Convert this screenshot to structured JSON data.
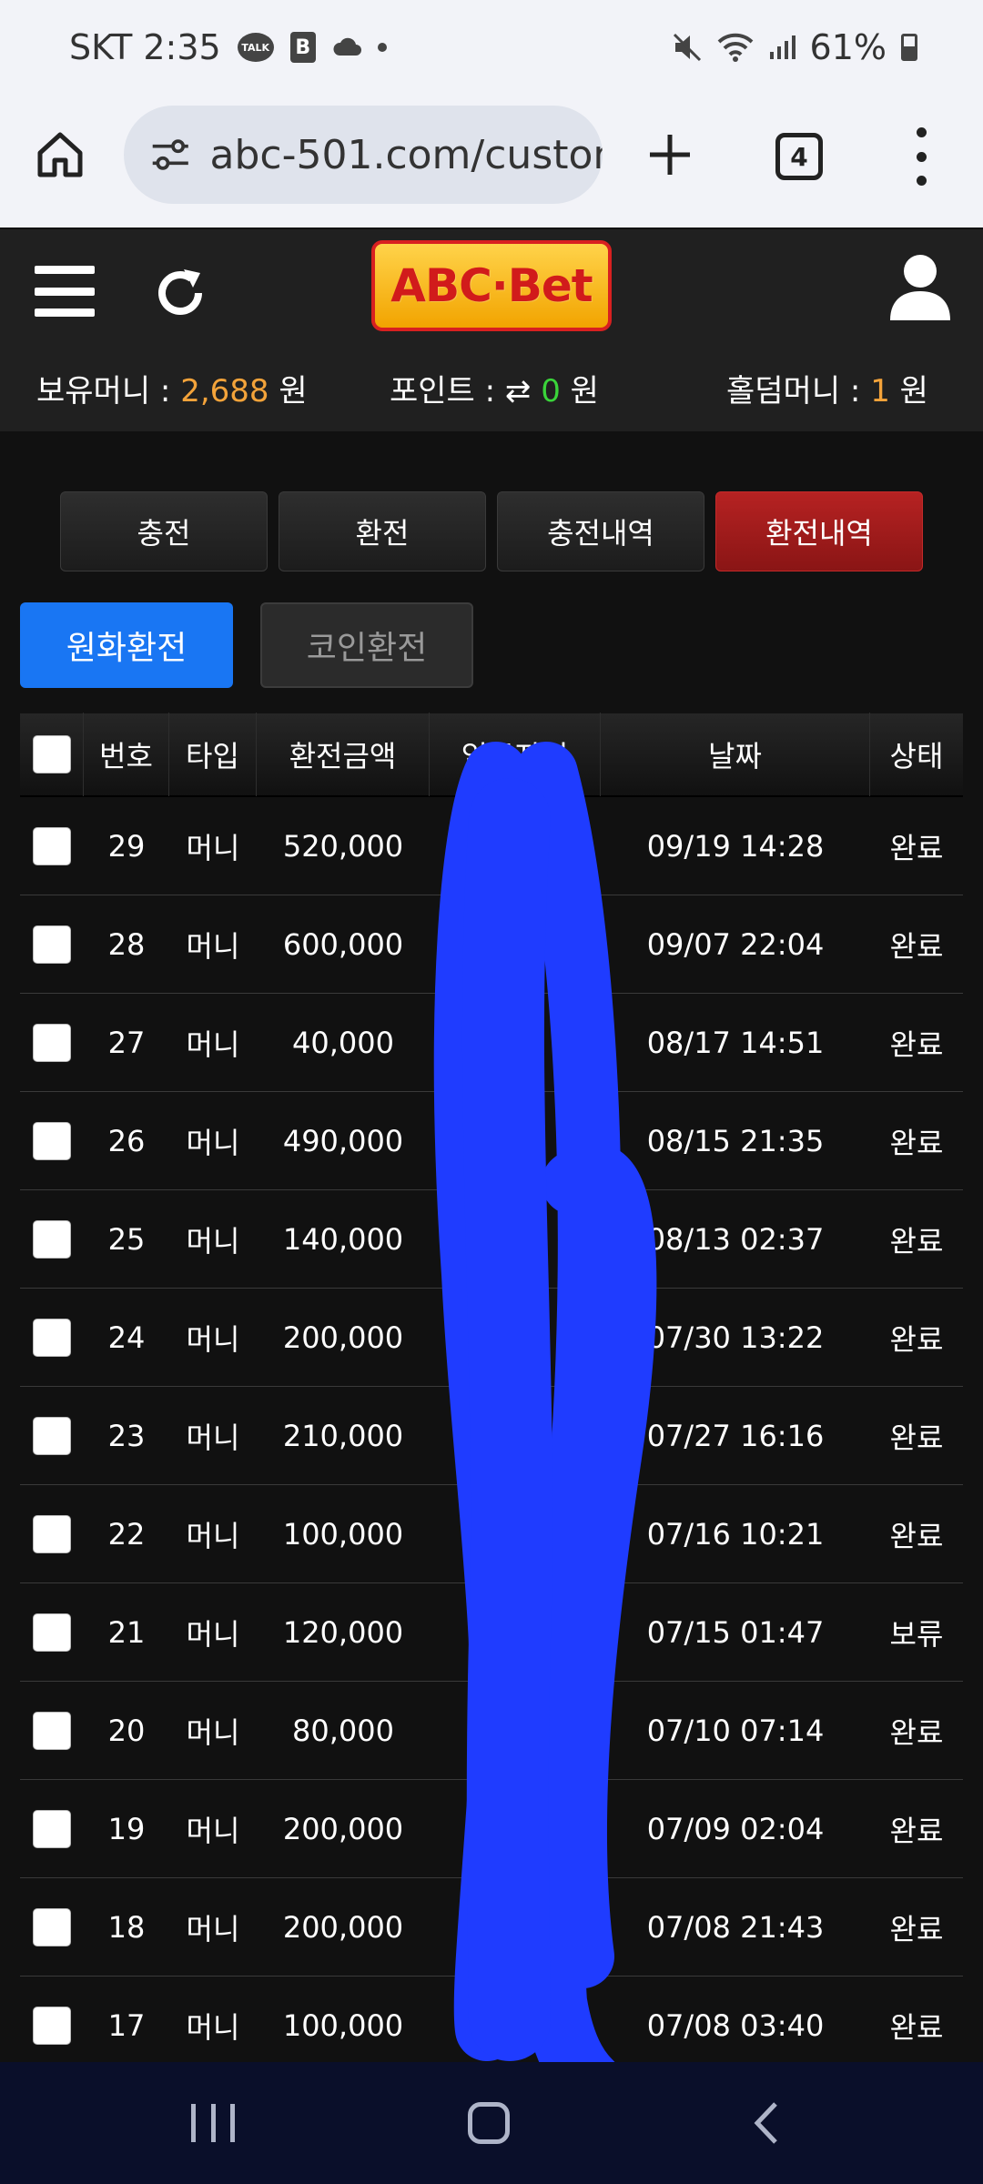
{
  "status": {
    "carrier_time": "SKT 2:35",
    "talk_label": "TALK",
    "b_label": "B",
    "battery": "61%"
  },
  "browser": {
    "url": "abc-501.com/custom",
    "tab_count": "4"
  },
  "header": {
    "logo": "ABC·Bet",
    "balance_label": "보유머니 : ",
    "balance_value": "2,688",
    "balance_unit": " 원",
    "point_label": "포인트 : ",
    "point_value": "0",
    "point_unit": " 원",
    "holdem_label": "홀덤머니 : ",
    "holdem_value": "1",
    "holdem_unit": " 원"
  },
  "tabs": [
    "충전",
    "환전",
    "충전내역",
    "환전내역"
  ],
  "subtabs": [
    "원화환전",
    "코인환전"
  ],
  "table": {
    "headers": [
      "번호",
      "타입",
      "환전금액",
      "입금자명",
      "날짜",
      "상태"
    ],
    "rows": [
      {
        "no": "29",
        "type": "머니",
        "amount": "520,000",
        "date": "09/19 14:28",
        "status": "완료"
      },
      {
        "no": "28",
        "type": "머니",
        "amount": "600,000",
        "date": "09/07 22:04",
        "status": "완료"
      },
      {
        "no": "27",
        "type": "머니",
        "amount": "40,000",
        "date": "08/17 14:51",
        "status": "완료"
      },
      {
        "no": "26",
        "type": "머니",
        "amount": "490,000",
        "date": "08/15 21:35",
        "status": "완료"
      },
      {
        "no": "25",
        "type": "머니",
        "amount": "140,000",
        "date": "08/13 02:37",
        "status": "완료"
      },
      {
        "no": "24",
        "type": "머니",
        "amount": "200,000",
        "date": "07/30 13:22",
        "status": "완료"
      },
      {
        "no": "23",
        "type": "머니",
        "amount": "210,000",
        "date": "07/27 16:16",
        "status": "완료"
      },
      {
        "no": "22",
        "type": "머니",
        "amount": "100,000",
        "date": "07/16 10:21",
        "status": "완료"
      },
      {
        "no": "21",
        "type": "머니",
        "amount": "120,000",
        "date": "07/15 01:47",
        "status": "보류"
      },
      {
        "no": "20",
        "type": "머니",
        "amount": "80,000",
        "date": "07/10 07:14",
        "status": "완료"
      },
      {
        "no": "19",
        "type": "머니",
        "amount": "200,000",
        "date": "07/09 02:04",
        "status": "완료"
      },
      {
        "no": "18",
        "type": "머니",
        "amount": "200,000",
        "date": "07/08 21:43",
        "status": "완료"
      },
      {
        "no": "17",
        "type": "머니",
        "amount": "100,000",
        "date": "07/08 03:40",
        "status": "완료"
      }
    ]
  },
  "colors": {
    "accent_blue": "#1976f3",
    "active_tab_red": "#b62222",
    "balance_orange": "#f3a33a",
    "point_green": "#3ad43a",
    "redaction_blue": "#1f3cff"
  }
}
